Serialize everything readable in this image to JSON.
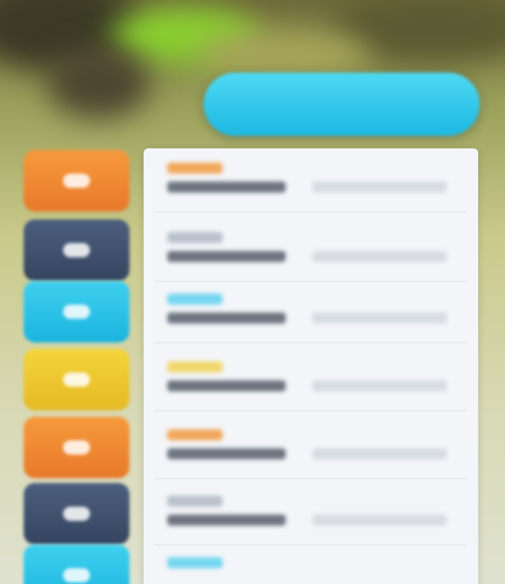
{
  "screen": {
    "banner_color": "#1cb8e3"
  },
  "list": {
    "items": [
      {
        "tile_color": "#e8792a",
        "accent_color": "#f2a75a",
        "icon": "orange-tile-icon"
      },
      {
        "tile_color": "#35455f",
        "accent_color": "#b9c1cd",
        "icon": "navy-tile-icon"
      },
      {
        "tile_color": "#1ab4df",
        "accent_color": "#74d6ef",
        "icon": "cyan-tile-icon"
      },
      {
        "tile_color": "#e6b923",
        "accent_color": "#f0d76a",
        "icon": "yellow-tile-icon"
      },
      {
        "tile_color": "#e8792a",
        "accent_color": "#f2a75a",
        "icon": "orange-tile-icon"
      },
      {
        "tile_color": "#35455f",
        "accent_color": "#b9c1cd",
        "icon": "navy-tile-icon"
      },
      {
        "tile_color": "#1ab4df",
        "accent_color": "#74d6ef",
        "icon": "cyan-tile-icon"
      }
    ]
  }
}
